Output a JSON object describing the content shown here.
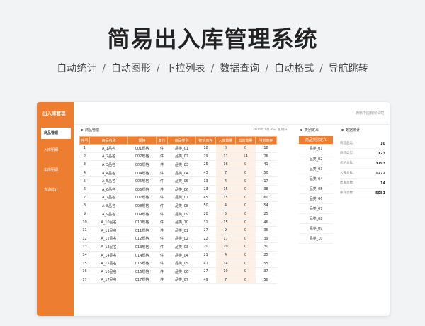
{
  "hero": {
    "title": "简易出入库管理系统",
    "features": [
      "自动统计",
      "自动图形",
      "下拉列表",
      "数据查询",
      "自动格式",
      "导航跳转"
    ],
    "separator": "/"
  },
  "app": {
    "title": "出入库管理",
    "company": "微软中国有限公司",
    "date": "2025年1月26日   星期日",
    "nav": [
      {
        "label": "商品管理",
        "active": true
      },
      {
        "label": "入库明细",
        "active": false
      },
      {
        "label": "出库明细",
        "active": false
      },
      {
        "label": "查询统计",
        "active": false
      }
    ]
  },
  "goods_panel": {
    "heading": "商品管理",
    "columns": [
      "序号",
      "商品名称",
      "规格",
      "单位",
      "商品类别",
      "初始库存",
      "入库数量",
      "出库数量",
      "当前库存"
    ],
    "rows": [
      [
        "1",
        "A_1品名",
        "001规格",
        "件",
        "品类_01",
        "18",
        "0",
        "0",
        "18"
      ],
      [
        "2",
        "A_2品名",
        "002规格",
        "件",
        "品类_02",
        "29",
        "11",
        "14",
        "26"
      ],
      [
        "3",
        "A_3品名",
        "003规格",
        "件",
        "品类_03",
        "25",
        "16",
        "0",
        "41"
      ],
      [
        "4",
        "A_4品名",
        "004规格",
        "件",
        "品类_04",
        "43",
        "7",
        "0",
        "50"
      ],
      [
        "5",
        "A_5品名",
        "005规格",
        "件",
        "品类_05",
        "13",
        "4",
        "0",
        "17"
      ],
      [
        "6",
        "A_6品名",
        "006规格",
        "件",
        "品类_06",
        "23",
        "15",
        "0",
        "38"
      ],
      [
        "7",
        "A_7品名",
        "007规格",
        "件",
        "品类_07",
        "45",
        "15",
        "0",
        "60"
      ],
      [
        "8",
        "A_8品名",
        "008规格",
        "件",
        "品类_08",
        "50",
        "4",
        "0",
        "54"
      ],
      [
        "9",
        "A_9品名",
        "009规格",
        "件",
        "品类_09",
        "20",
        "5",
        "0",
        "25"
      ],
      [
        "10",
        "A_10品名",
        "010规格",
        "件",
        "品类_10",
        "31",
        "15",
        "0",
        "46"
      ],
      [
        "11",
        "A_11品名",
        "011规格",
        "件",
        "品类_01",
        "27",
        "9",
        "0",
        "36"
      ],
      [
        "12",
        "A_12品名",
        "012规格",
        "件",
        "品类_02",
        "22",
        "17",
        "0",
        "39"
      ],
      [
        "13",
        "A_13品名",
        "013规格",
        "件",
        "品类_03",
        "20",
        "10",
        "0",
        "30"
      ],
      [
        "14",
        "A_14品名",
        "014规格",
        "件",
        "品类_04",
        "21",
        "4",
        "0",
        "25"
      ],
      [
        "15",
        "A_15品名",
        "015规格",
        "件",
        "品类_05",
        "41",
        "14",
        "0",
        "55"
      ],
      [
        "16",
        "A_16品名",
        "016规格",
        "件",
        "品类_06",
        "27",
        "10",
        "0",
        "37"
      ],
      [
        "17",
        "A_17品名",
        "017规格",
        "件",
        "品类_07",
        "49",
        "7",
        "0",
        "56"
      ]
    ]
  },
  "category_panel": {
    "heading": "类别定义",
    "column": "商品类别定义",
    "items": [
      "品类_01",
      "品类_02",
      "品类_03",
      "品类_04",
      "品类_05",
      "品类_06",
      "品类_07",
      "品类_08",
      "品类_09",
      "品类_10"
    ]
  },
  "stats_panel": {
    "heading": "数据统计",
    "items": [
      {
        "label": "商品品类：",
        "value": "10"
      },
      {
        "label": "商品类型：",
        "value": "123"
      },
      {
        "label": "初始总数：",
        "value": "3793"
      },
      {
        "label": "入库总数：",
        "value": "1272"
      },
      {
        "label": "出库总数：",
        "value": "14"
      },
      {
        "label": "库存总数：",
        "value": "5051"
      }
    ]
  },
  "colors": {
    "accent": "#ed7d31",
    "highlight": "#fdf1e7"
  }
}
